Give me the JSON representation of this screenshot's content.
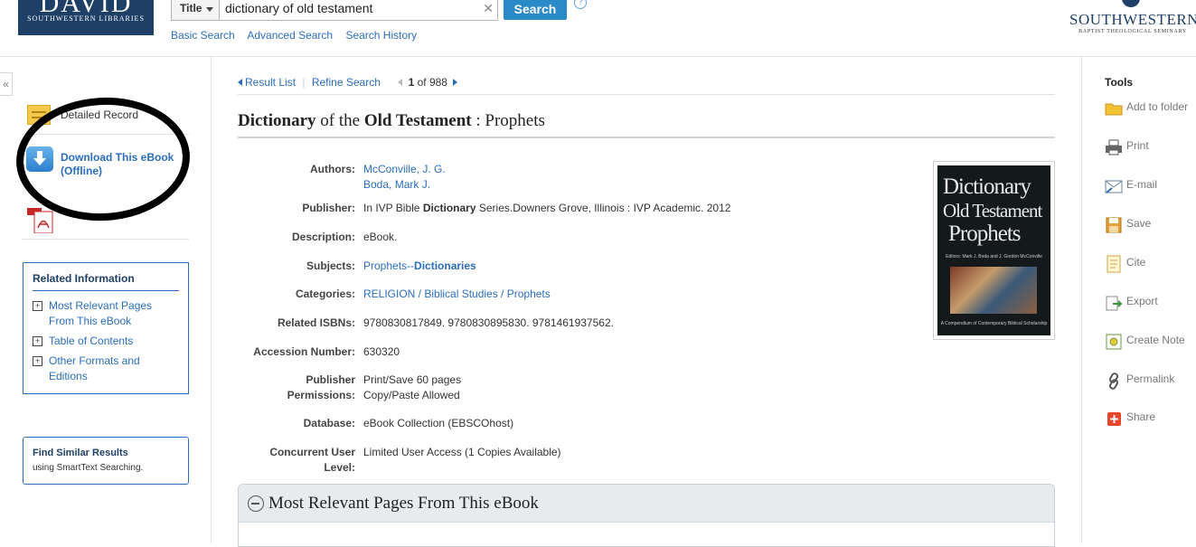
{
  "header": {
    "logo_big": "DAVID",
    "logo_small": "SOUTHWESTERN LIBRARIES",
    "field_select": "Title",
    "search_value": "dictionary of old testament",
    "search_button": "Search",
    "help": "?",
    "links": [
      "Basic Search",
      "Advanced Search",
      "Search History"
    ],
    "brand_name": "SOUTHWESTERN",
    "brand_sub": "BAPTIST THEOLOGICAL SEMINARY"
  },
  "left": {
    "collapse": "«",
    "detailed_record": "Detailed Record",
    "download_line1": "Download This eBook",
    "download_line2": "(Offline)",
    "related_title": "Related Information",
    "related_items": [
      {
        "line1": "Most Relevant Pages",
        "line2": "From This eBook"
      },
      {
        "line1": "Table of Contents",
        "line2": ""
      },
      {
        "line1": "Other Formats and",
        "line2": "Editions"
      }
    ],
    "similar_title": "Find Similar Results",
    "similar_sub": "using SmartText Searching."
  },
  "nav": {
    "result_list": "Result List",
    "refine_search": "Refine Search",
    "position": "1",
    "of_total": "of 988"
  },
  "record": {
    "title_w1": "Dictionary",
    "title_w2": " of the ",
    "title_w3": "Old Testament",
    "title_w4": " : Prophets",
    "authors_label": "Authors:",
    "authors": [
      "McConville, J. G.",
      "Boda, Mark J."
    ],
    "publisher_label": "Publisher:",
    "publisher_pre": "In IVP Bible ",
    "publisher_bold": "Dictionary",
    "publisher_post": " Series.Downers Grove, Illinois : IVP Academic. 2012",
    "description_label": "Description:",
    "description": "eBook.",
    "subjects_label": "Subjects:",
    "subjects_pre": "Prophets--",
    "subjects_bold": "Dictionaries",
    "categories_label": "Categories:",
    "categories": "RELIGION / Biblical Studies / Prophets",
    "isbns_label": "Related ISBNs:",
    "isbns": "9780830817849. 9780830895830. 9781461937562.",
    "accession_label": "Accession Number:",
    "accession": "630320",
    "permissions_label1": "Publisher",
    "permissions_label2": "Permissions:",
    "permissions_line1": "Print/Save 60 pages",
    "permissions_line2": "Copy/Paste Allowed",
    "database_label": "Database:",
    "database": "eBook Collection (EBSCOhost)",
    "concurrent_label": "Concurrent User Level:",
    "concurrent": "Limited User Access (1 Copies Available)"
  },
  "cover": {
    "line1": "Dictionary",
    "line2": "Old Testament",
    "line3": "Prophets",
    "editors": "Editors: Mark J. Boda and J. Gordon McConville",
    "series": "A Compendium of Contemporary Biblical Scholarship"
  },
  "panel": {
    "title": "Most Relevant Pages From This eBook"
  },
  "tools": {
    "title": "Tools",
    "items": [
      "Add to folder",
      "Print",
      "E-mail",
      "Save",
      "Cite",
      "Export",
      "Create Note",
      "Permalink",
      "Share"
    ]
  }
}
